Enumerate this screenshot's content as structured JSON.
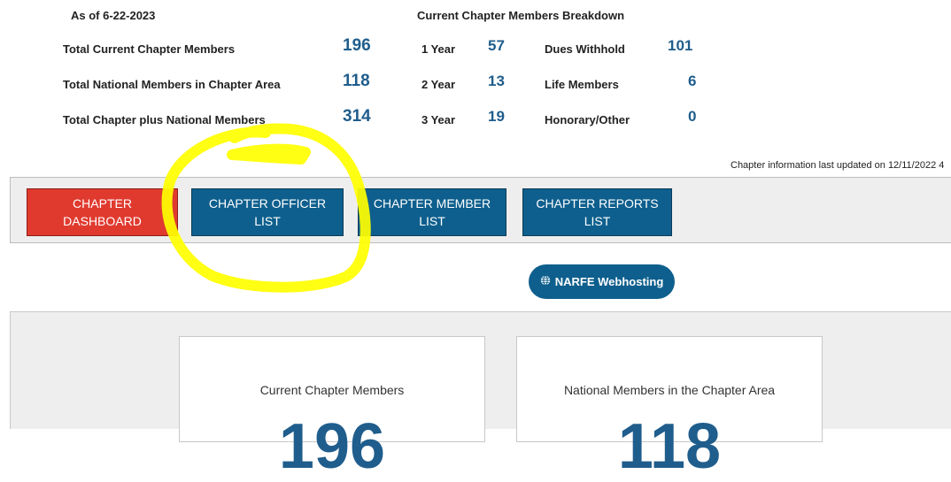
{
  "summary": {
    "as_of": "As of 6-22-2023",
    "breakdown_title": "Current Chapter Members Breakdown",
    "totals": [
      {
        "label": "Total Current Chapter Members",
        "value": "196"
      },
      {
        "label": "Total National Members in Chapter Area",
        "value": "118"
      },
      {
        "label": "Total Chapter plus National Members",
        "value": "314"
      }
    ],
    "years": [
      {
        "label": "1 Year",
        "value": "57"
      },
      {
        "label": "2 Year",
        "value": "13"
      },
      {
        "label": "3 Year",
        "value": "19"
      }
    ],
    "types": [
      {
        "label": "Dues Withhold",
        "value": "101"
      },
      {
        "label": "Life Members",
        "value": "6"
      },
      {
        "label": "Honorary/Other",
        "value": "0"
      }
    ]
  },
  "updated_text": "Chapter information last updated on 12/11/2022 4",
  "nav": [
    {
      "line1": "CHAPTER",
      "line2": "DASHBOARD"
    },
    {
      "line1": "CHAPTER OFFICER",
      "line2": "LIST"
    },
    {
      "line1": "CHAPTER MEMBER",
      "line2": "LIST"
    },
    {
      "line1": "CHAPTER REPORTS",
      "line2": "LIST"
    }
  ],
  "webhosting_label": "NARFE Webhosting",
  "cards": [
    {
      "title": "Current Chapter Members",
      "value": "196"
    },
    {
      "title": "National Members in the Chapter Area",
      "value": "118"
    }
  ],
  "colors": {
    "accent_blue": "#0e5f8d",
    "active_red": "#e03a2f",
    "number_blue": "#1f5d8c",
    "highlight_yellow": "#ffff00"
  },
  "icons": {
    "webhosting": "globe-icon"
  }
}
